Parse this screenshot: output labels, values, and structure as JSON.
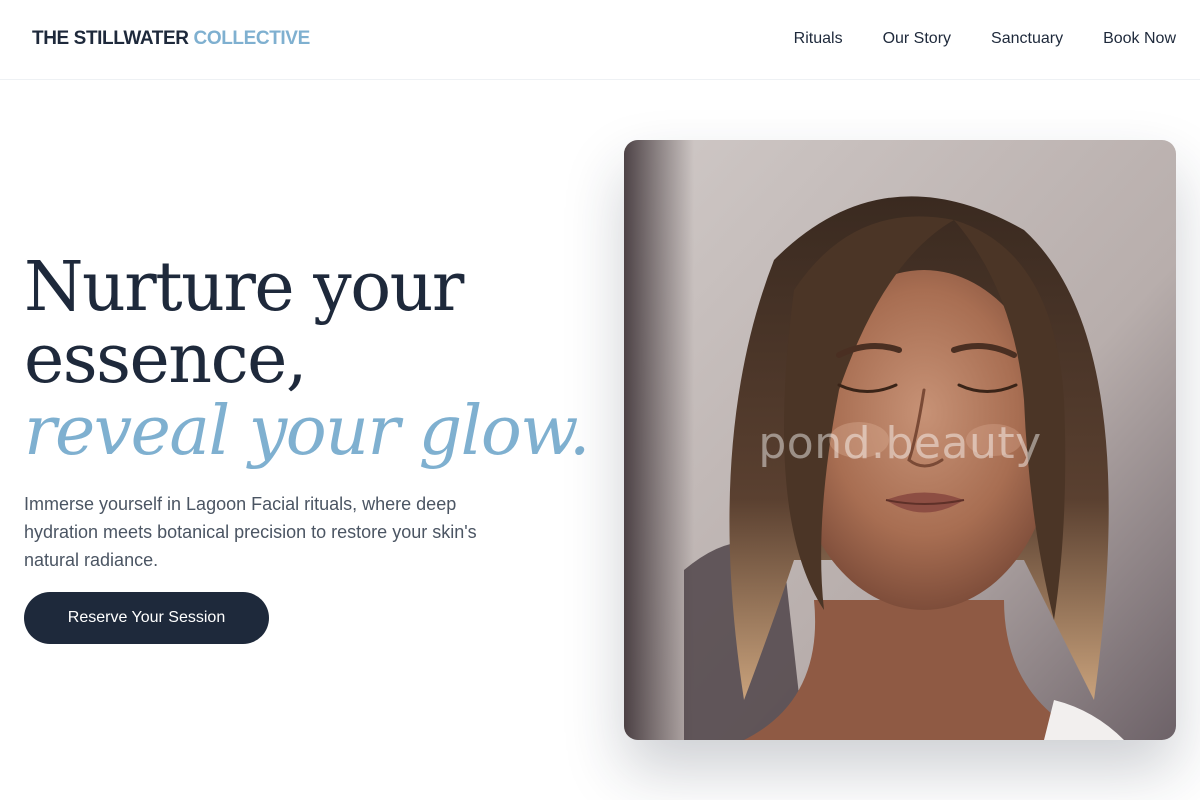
{
  "brand": {
    "name_main": "THE STILLWATER",
    "name_accent": "COLLECTIVE",
    "main_color": "#1e293b",
    "accent_color": "#7fb0d0"
  },
  "nav": {
    "items": [
      "Rituals",
      "Our Story",
      "Sanctuary",
      "Book Now"
    ]
  },
  "hero": {
    "title_line1": "Nurture your",
    "title_line2": "essence,",
    "title_line3": "reveal your glow.",
    "description": "Immerse yourself in Lagoon Facial rituals, where deep hydration meets botanical precision to restore your skin's natural radiance.",
    "cta_label": "Reserve Your Session"
  },
  "photo": {
    "subject": "portrait-woman-eyes-closed",
    "watermark": "pond.beauty"
  }
}
